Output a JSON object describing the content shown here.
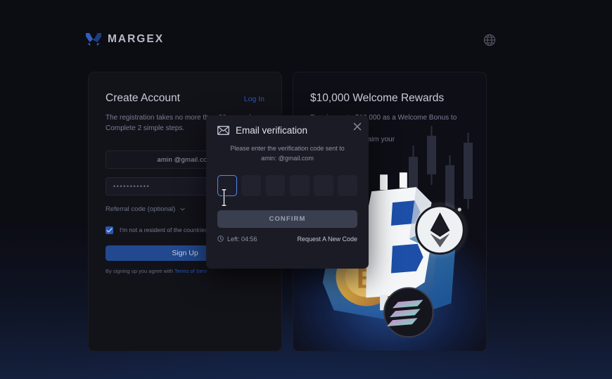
{
  "header": {
    "logo_text": "MARGEX",
    "logo_icon": "margex-m-logo-icon",
    "language_icon": "globe-icon"
  },
  "signup_card": {
    "title": "Create Account",
    "login_label": "Log In",
    "subtitle": "The registration takes no more than 30 seconds. Complete 2 simple steps.",
    "email_value": "amin    @gmail.com",
    "password_value": "•••••••••••",
    "referral_label": "Referral code (optional)",
    "referral_chevron_icon": "chevron-down-icon",
    "checkbox_icon": "check-icon",
    "checkbox_checked": true,
    "residency_text": "I'm not a resident of the countries wi...  service.",
    "signup_button_label": "Sign Up",
    "agree_prefix": "By signing up you agree with ",
    "agree_link": "Terms of Serv"
  },
  "promo_card": {
    "title": "$10,000 Welcome Rewards",
    "subtitle_line1": "Receive up to $10,000 as a Welcome Bonus to start",
    "subtitle_line2": "! Deposit now to claim your",
    "artwork_icon": "crypto-ice-block-artwork"
  },
  "modal": {
    "title": "Email verification",
    "title_icon": "envelope-icon",
    "close_icon": "close-icon",
    "description_line1": "Please enter the verification code sent to",
    "description_line2": "amin:    @gmail.com",
    "code_boxes": [
      "",
      "",
      "",
      "",
      "",
      ""
    ],
    "active_box_index": 0,
    "confirm_label": "CONFIRM",
    "timer_icon": "clock-icon",
    "timer_label": "Left: 04:56",
    "resend_label": "Request A New Code"
  },
  "colors": {
    "page_background": "#0c0c13",
    "card_background": "#121219",
    "modal_background": "#1b1b26",
    "accent_blue": "#2d56b5",
    "focus_blue": "#4f8af0",
    "signup_button": "#22498f",
    "confirm_button": "#3a3f50",
    "muted_text": "#787f93"
  }
}
